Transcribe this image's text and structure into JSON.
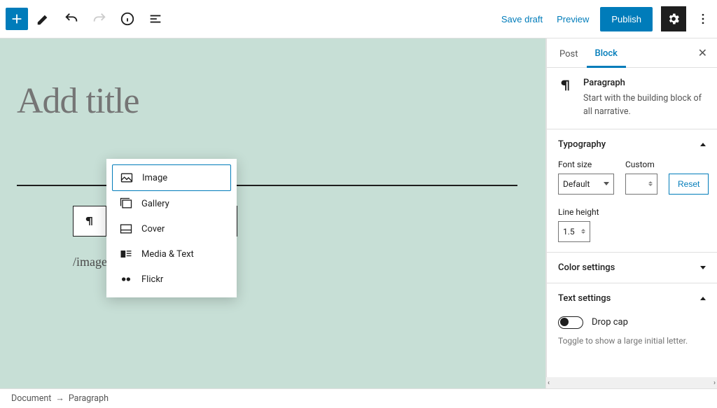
{
  "toolbar": {
    "save_draft": "Save draft",
    "preview": "Preview",
    "publish": "Publish"
  },
  "canvas": {
    "title_placeholder": "Add title",
    "slash_command": "/image"
  },
  "inserter": {
    "items": [
      {
        "label": "Image",
        "icon": "image-icon"
      },
      {
        "label": "Gallery",
        "icon": "gallery-icon"
      },
      {
        "label": "Cover",
        "icon": "cover-icon"
      },
      {
        "label": "Media & Text",
        "icon": "media-text-icon"
      },
      {
        "label": "Flickr",
        "icon": "flickr-icon"
      }
    ]
  },
  "sidebar": {
    "tabs": {
      "post": "Post",
      "block": "Block"
    },
    "block_name": "Paragraph",
    "block_desc": "Start with the building block of all narrative.",
    "typography": {
      "title": "Typography",
      "font_size_label": "Font size",
      "font_size_value": "Default",
      "custom_label": "Custom",
      "reset": "Reset",
      "line_height_label": "Line height",
      "line_height_value": "1.5"
    },
    "color_settings": "Color settings",
    "text_settings": {
      "title": "Text settings",
      "drop_cap": "Drop cap",
      "hint": "Toggle to show a large initial letter."
    }
  },
  "breadcrumb": {
    "doc": "Document",
    "sep": "→",
    "node": "Paragraph"
  }
}
